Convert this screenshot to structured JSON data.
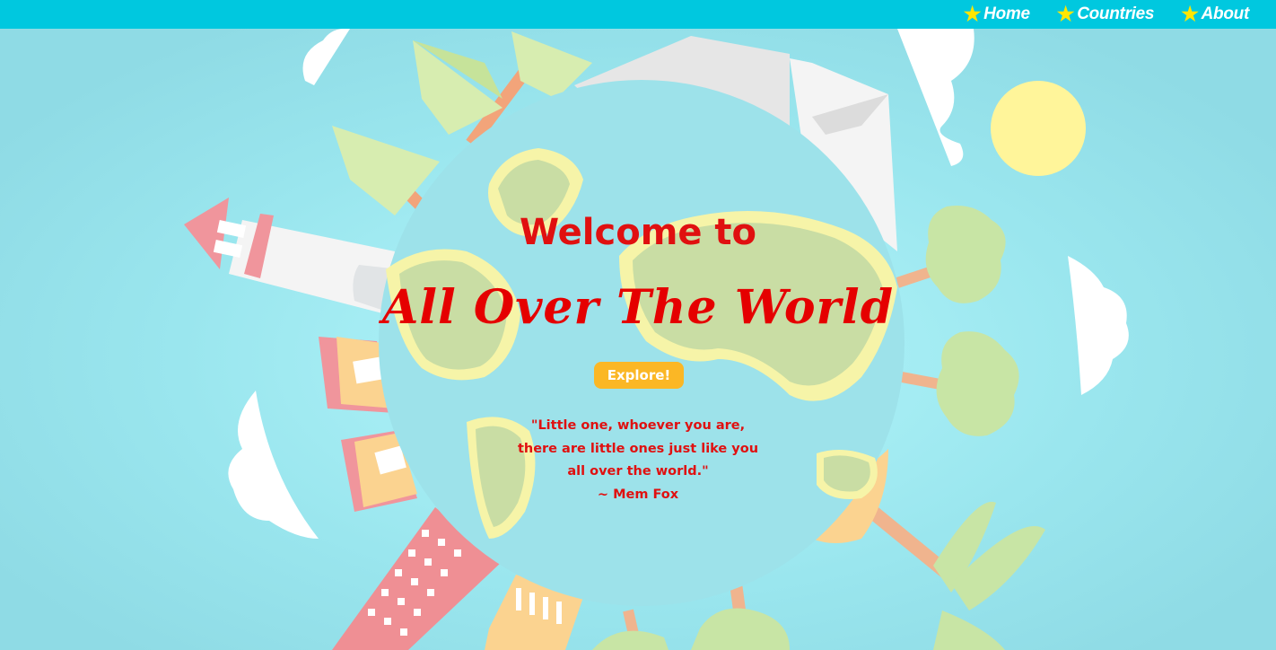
{
  "nav": {
    "items": [
      {
        "label": "Home",
        "icon": "star-icon"
      },
      {
        "label": "Countries",
        "icon": "star-icon"
      },
      {
        "label": "About",
        "icon": "star-icon"
      }
    ]
  },
  "hero": {
    "welcome": "Welcome to",
    "title": "All Over The World",
    "button_label": "Explore!",
    "quote_lines": [
      "\"Little one, whoever you are,",
      "there are little ones just like you",
      "all over the world.\"",
      "~ Mem Fox"
    ]
  },
  "colors": {
    "nav_bar": "#00c8df",
    "background": "#8fdfe8",
    "accent_red": "#e01010",
    "button": "#fbb725",
    "star": "#ffe600",
    "sun": "#fff59a"
  }
}
